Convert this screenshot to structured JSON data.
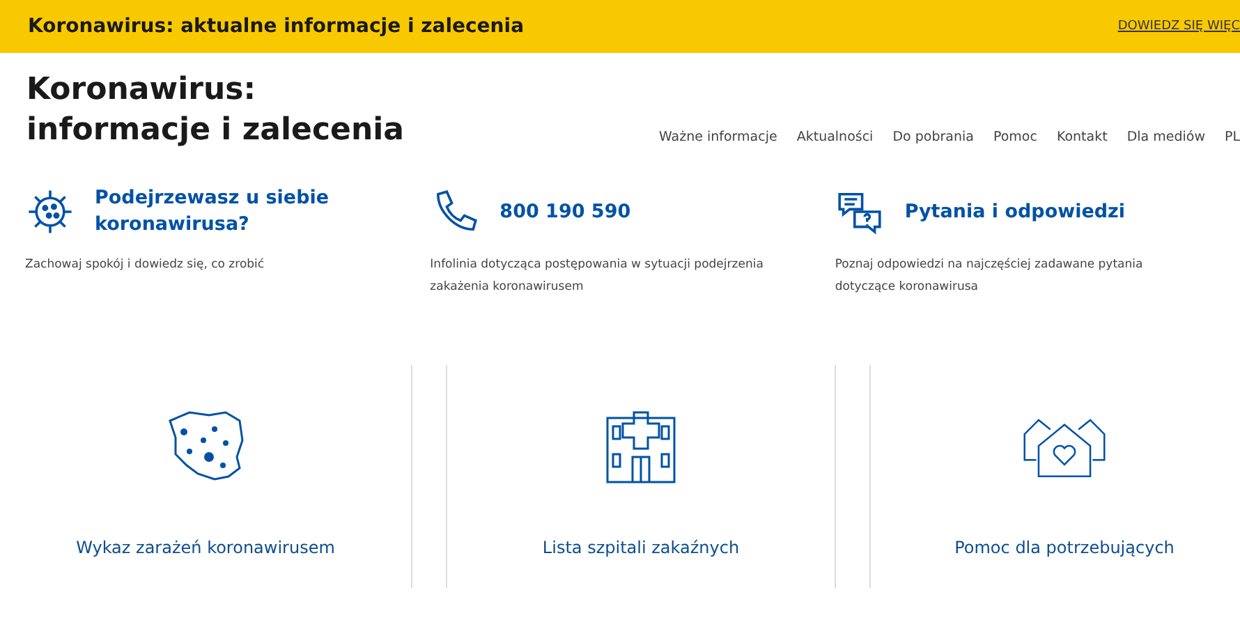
{
  "banner": {
    "text": "Koronawirus: aktualne informacje i zalecenia",
    "link": "DOWIEDZ SIĘ WIĘC"
  },
  "header": {
    "title_lines": [
      "Koronawirus:",
      "informacje i zalecenia"
    ],
    "nav": [
      "Ważne informacje",
      "Aktualności",
      "Do pobrania",
      "Pomoc",
      "Kontakt",
      "Dla mediów"
    ],
    "language": "PL"
  },
  "info": [
    {
      "kind": "virus",
      "title": "Podejrzewasz u siebie koronawirusa?",
      "text": "Zachowaj spokój i dowiedz się, co zrobić"
    },
    {
      "kind": "phone",
      "title": "800 190 590",
      "text": "Infolinia dotycząca postępowania w sytuacji podejrzenia zakażenia koronawirusem"
    },
    {
      "kind": "faq",
      "title": "Pytania i odpowiedzi",
      "text": "Poznaj odpowiedzi na najczęściej zadawane pytania dotyczące koronawirusa"
    }
  ],
  "tiles": [
    {
      "kind": "map",
      "label": "Wykaz zarażeń koronawirusem"
    },
    {
      "kind": "hospital",
      "label": "Lista szpitali zakaźnych"
    },
    {
      "kind": "houses",
      "label": "Pomoc dla potrzebujących"
    }
  ]
}
